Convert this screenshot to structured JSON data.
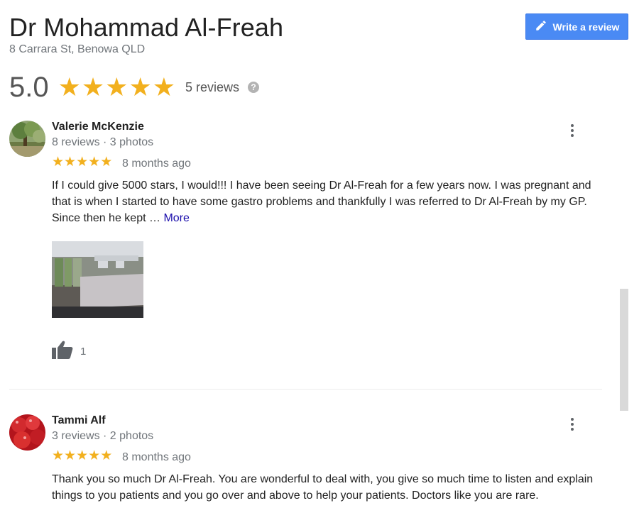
{
  "header": {
    "title": "Dr Mohammad Al-Freah",
    "address": "8 Carrara St, Benowa QLD",
    "write_review_label": "Write a review"
  },
  "summary": {
    "rating": "5.0",
    "stars": 5,
    "review_count": "5 reviews"
  },
  "reviews": [
    {
      "name": "Valerie McKenzie",
      "meta": "8 reviews · 3 photos",
      "stars": 5,
      "time": "8 months ago",
      "text": "If I could give 5000 stars, I would!!! I have been seeing Dr Al-Freah for a few years now. I was pregnant and that is when I started to have some gastro problems and thankfully I was referred to Dr Al-Freah by my GP. Since then he kept … ",
      "more_label": "More",
      "likes": "1"
    },
    {
      "name": "Tammi Alf",
      "meta": "3 reviews · 2 photos",
      "stars": 5,
      "time": "8 months ago",
      "text": "Thank you so much Dr Al-Freah. You are wonderful to deal with, you give so much time to listen and explain things to you patients and you go over and above to help your patients. Doctors like you are rare."
    }
  ],
  "colors": {
    "star": "#f2b01e",
    "button": "#4a8af4",
    "link": "#1a0dab",
    "muted": "#70757a"
  },
  "icons": {
    "write_review": "pencil-icon",
    "help": "help-icon",
    "menu": "more-vert-icon",
    "like": "thumbs-up-icon"
  }
}
